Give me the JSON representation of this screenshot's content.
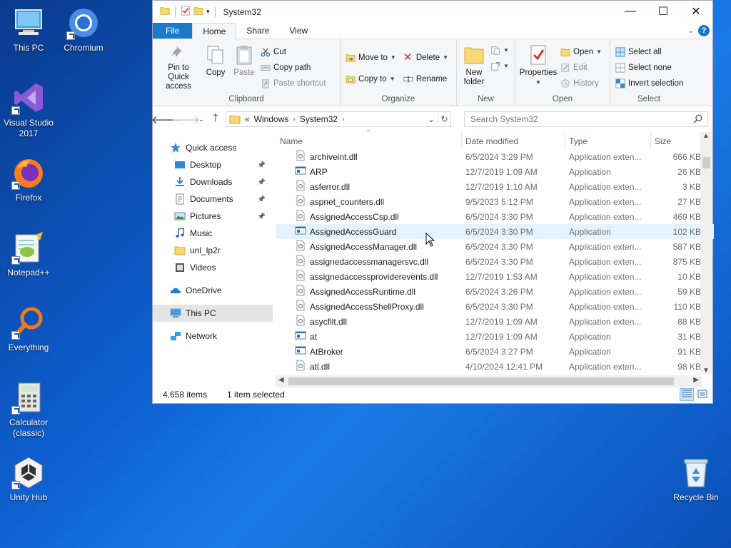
{
  "desktop": {
    "icons": [
      {
        "label": "This PC",
        "icon": "this-pc-icon"
      },
      {
        "label": "Chromium",
        "icon": "chromium-icon"
      },
      {
        "label": "Visual Studio 2017",
        "icon": "visual-studio-icon"
      },
      {
        "label": "Firefox",
        "icon": "firefox-icon"
      },
      {
        "label": "Notepad++",
        "icon": "notepad-plus-plus-icon"
      },
      {
        "label": "Everything",
        "icon": "everything-search-icon"
      },
      {
        "label": "Calculator (classic)",
        "icon": "calculator-icon"
      },
      {
        "label": "Unity Hub",
        "icon": "unity-hub-icon"
      },
      {
        "label": "Recycle Bin",
        "icon": "recycle-bin-icon"
      }
    ]
  },
  "window": {
    "title": "System32",
    "controls": {
      "minimize": "—",
      "maximize": "☐",
      "close": "✕"
    }
  },
  "tabs": {
    "file": "File",
    "home": "Home",
    "share": "Share",
    "view": "View",
    "help": "?"
  },
  "ribbon": {
    "clipboard": {
      "label": "Clipboard",
      "pin": "Pin to Quick access",
      "copy": "Copy",
      "paste": "Paste",
      "cut": "Cut",
      "copy_path": "Copy path",
      "paste_shortcut": "Paste shortcut"
    },
    "organize": {
      "label": "Organize",
      "move_to": "Move to",
      "copy_to": "Copy to",
      "delete": "Delete",
      "rename": "Rename"
    },
    "new": {
      "label": "New",
      "new_folder": "New folder"
    },
    "open": {
      "label": "Open",
      "properties": "Properties",
      "open": "Open",
      "edit": "Edit",
      "history": "History"
    },
    "select": {
      "label": "Select",
      "select_all": "Select all",
      "select_none": "Select none",
      "invert": "Invert selection"
    }
  },
  "address": {
    "prefix": "«",
    "crumbs": [
      "Windows",
      "System32"
    ],
    "search_placeholder": "Search System32"
  },
  "nav": {
    "items": [
      {
        "label": "Quick access",
        "icon": "star-icon",
        "indent": 1,
        "pinned": false
      },
      {
        "label": "Desktop",
        "icon": "desktop-folder-icon",
        "indent": 2,
        "pinned": true
      },
      {
        "label": "Downloads",
        "icon": "downloads-icon",
        "indent": 2,
        "pinned": true
      },
      {
        "label": "Documents",
        "icon": "documents-icon",
        "indent": 2,
        "pinned": true
      },
      {
        "label": "Pictures",
        "icon": "pictures-icon",
        "indent": 2,
        "pinned": true
      },
      {
        "label": "Music",
        "icon": "music-icon",
        "indent": 2,
        "pinned": false
      },
      {
        "label": "unl_lp2r",
        "icon": "folder-icon",
        "indent": 2,
        "pinned": false
      },
      {
        "label": "Videos",
        "icon": "videos-icon",
        "indent": 2,
        "pinned": false
      },
      {
        "label": "OneDrive",
        "icon": "onedrive-icon",
        "indent": 1,
        "pinned": false
      },
      {
        "label": "This PC",
        "icon": "this-pc-icon",
        "indent": 1,
        "pinned": false,
        "selected": true
      },
      {
        "label": "Network",
        "icon": "network-icon",
        "indent": 1,
        "pinned": false
      }
    ]
  },
  "columns": {
    "name": "Name",
    "date": "Date modified",
    "type": "Type",
    "size": "Size"
  },
  "files": [
    {
      "name": "archiveint.dll",
      "date": "6/5/2024 3:29 PM",
      "type": "Application exten...",
      "size": "666 KB",
      "kind": "dll"
    },
    {
      "name": "ARP",
      "date": "12/7/2019 1:09 AM",
      "type": "Application",
      "size": "26 KB",
      "kind": "exe"
    },
    {
      "name": "asferror.dll",
      "date": "12/7/2019 1:10 AM",
      "type": "Application exten...",
      "size": "3 KB",
      "kind": "dll"
    },
    {
      "name": "aspnet_counters.dll",
      "date": "9/5/2023 5:12 PM",
      "type": "Application exten...",
      "size": "27 KB",
      "kind": "dll"
    },
    {
      "name": "AssignedAccessCsp.dll",
      "date": "6/5/2024 3:30 PM",
      "type": "Application exten...",
      "size": "469 KB",
      "kind": "dll"
    },
    {
      "name": "AssignedAccessGuard",
      "date": "6/5/2024 3:30 PM",
      "type": "Application",
      "size": "102 KB",
      "kind": "exe",
      "hot": true
    },
    {
      "name": "AssignedAccessManager.dll",
      "date": "6/5/2024 3:30 PM",
      "type": "Application exten...",
      "size": "587 KB",
      "kind": "dll"
    },
    {
      "name": "assignedaccessmanagersvc.dll",
      "date": "6/5/2024 3:30 PM",
      "type": "Application exten...",
      "size": "875 KB",
      "kind": "dll"
    },
    {
      "name": "assignedaccessproviderevents.dll",
      "date": "12/7/2019 1:53 AM",
      "type": "Application exten...",
      "size": "10 KB",
      "kind": "dll"
    },
    {
      "name": "AssignedAccessRuntime.dll",
      "date": "6/5/2024 3:26 PM",
      "type": "Application exten...",
      "size": "59 KB",
      "kind": "dll"
    },
    {
      "name": "AssignedAccessShellProxy.dll",
      "date": "6/5/2024 3:30 PM",
      "type": "Application exten...",
      "size": "110 KB",
      "kind": "dll"
    },
    {
      "name": "asycfilt.dll",
      "date": "12/7/2019 1:09 AM",
      "type": "Application exten...",
      "size": "88 KB",
      "kind": "dll"
    },
    {
      "name": "at",
      "date": "12/7/2019 1:09 AM",
      "type": "Application",
      "size": "31 KB",
      "kind": "exe"
    },
    {
      "name": "AtBroker",
      "date": "6/5/2024 3:27 PM",
      "type": "Application",
      "size": "91 KB",
      "kind": "exe"
    },
    {
      "name": "atl.dll",
      "date": "4/10/2024 12:41 PM",
      "type": "Application exten...",
      "size": "98 KB",
      "kind": "dll"
    }
  ],
  "status": {
    "count": "4,658 items",
    "selected": "1 item selected"
  },
  "colors": {
    "accent": "#1979ca",
    "hover_row": "#e5f3ff",
    "nav_selected": "#e5e5e5"
  }
}
